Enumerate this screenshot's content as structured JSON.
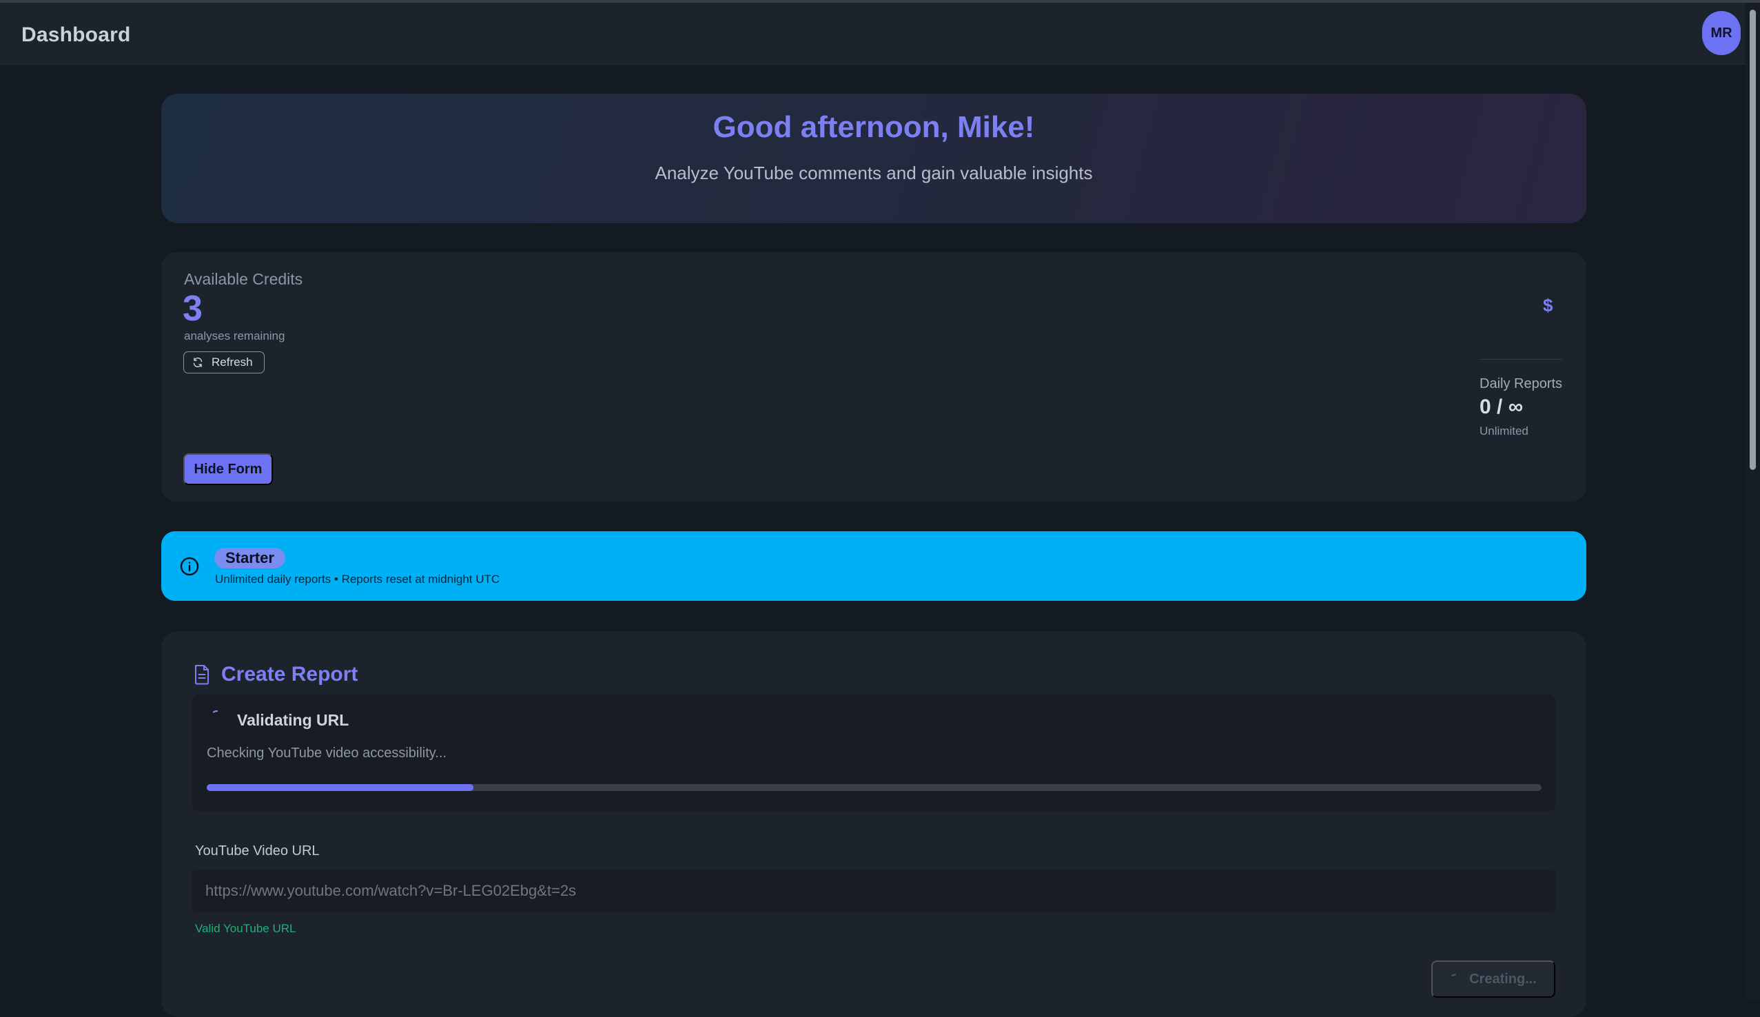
{
  "header": {
    "title": "Dashboard",
    "avatar_initials": "MR"
  },
  "hero": {
    "greeting": "Good afternoon, Mike!",
    "subtitle": "Analyze YouTube comments and gain valuable insights"
  },
  "credits": {
    "label": "Available Credits",
    "value": "3",
    "sublabel": "analyses remaining",
    "refresh_label": "Refresh",
    "currency_icon": "$",
    "daily_reports_label": "Daily Reports",
    "daily_reports_value": "0 / ∞",
    "daily_reports_sub": "Unlimited",
    "hide_form_label": "Hide Form"
  },
  "plan": {
    "name": "Starter",
    "description": "Unlimited daily reports • Reports reset at midnight UTC"
  },
  "report": {
    "title": "Create Report",
    "status_title": "Validating URL",
    "status_message": "Checking YouTube video accessibility...",
    "progress": 0.2,
    "url_label": "YouTube Video URL",
    "url_placeholder": "https://www.youtube.com/watch?v=Br-LEG02Ebg&t=2s",
    "url_valid_message": "Valid YouTube URL",
    "submit_label": "Creating..."
  },
  "colors": {
    "accent": "#6d72f2",
    "heading": "#7c80f3",
    "plan_banner": "#00b0f5",
    "valid": "#22b07a",
    "background": "#141a22",
    "card": "#1c232c"
  },
  "icons": [
    "refresh-icon",
    "info-icon",
    "document-icon",
    "spinner-icon"
  ]
}
